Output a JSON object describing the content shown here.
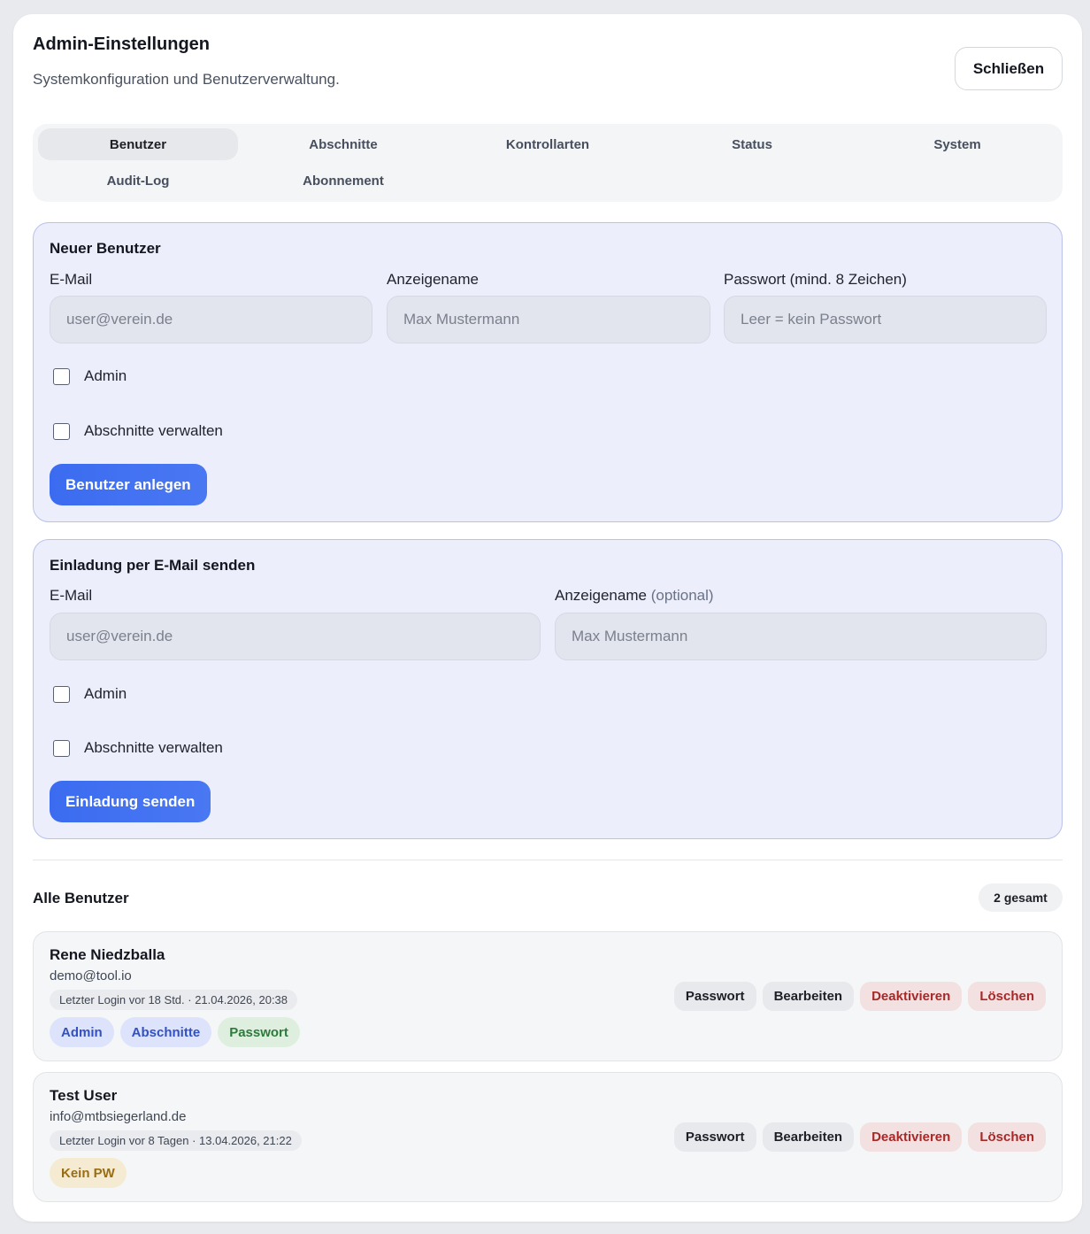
{
  "header": {
    "title": "Admin-Einstellungen",
    "subtitle": "Systemkonfiguration und Benutzerverwaltung.",
    "close_label": "Schließen"
  },
  "tabs": [
    {
      "label": "Benutzer",
      "active": true
    },
    {
      "label": "Abschnitte"
    },
    {
      "label": "Kontrollarten"
    },
    {
      "label": "Status"
    },
    {
      "label": "System"
    },
    {
      "label": "Audit-Log"
    },
    {
      "label": "Abonnement"
    }
  ],
  "new_user": {
    "title": "Neuer Benutzer",
    "email_label": "E-Mail",
    "email_placeholder": "user@verein.de",
    "name_label": "Anzeigename",
    "name_placeholder": "Max Mustermann",
    "password_label": "Passwort (mind. 8 Zeichen)",
    "password_placeholder": "Leer = kein Passwort",
    "admin_label": "Admin",
    "sections_label": "Abschnitte verwalten",
    "submit_label": "Benutzer anlegen"
  },
  "invite": {
    "title": "Einladung per E-Mail senden",
    "email_label": "E-Mail",
    "email_placeholder": "user@verein.de",
    "name_label": "Anzeigename",
    "name_optional": "(optional)",
    "name_placeholder": "Max Mustermann",
    "admin_label": "Admin",
    "sections_label": "Abschnitte verwalten",
    "submit_label": "Einladung senden"
  },
  "users_section": {
    "title": "Alle Benutzer",
    "count": "2 gesamt"
  },
  "users": [
    {
      "name": "Rene Niedzballa",
      "email": "demo@tool.io",
      "last_login": "Letzter Login vor 18 Std. · 21.04.2026, 20:38",
      "tags": [
        "Admin",
        "Abschnitte",
        "Passwort"
      ]
    },
    {
      "name": "Test User",
      "email": "info@mtbsiegerland.de",
      "last_login": "Letzter Login vor 8 Tagen · 13.04.2026, 21:22",
      "tags": [
        "Kein PW"
      ]
    }
  ],
  "user_actions": {
    "password": "Passwort",
    "edit": "Bearbeiten",
    "deactivate": "Deaktivieren",
    "delete": "Löschen"
  },
  "colors": {
    "primary": "#3b6bf0",
    "danger": "#a82828",
    "card_bg": "#eceefb"
  }
}
